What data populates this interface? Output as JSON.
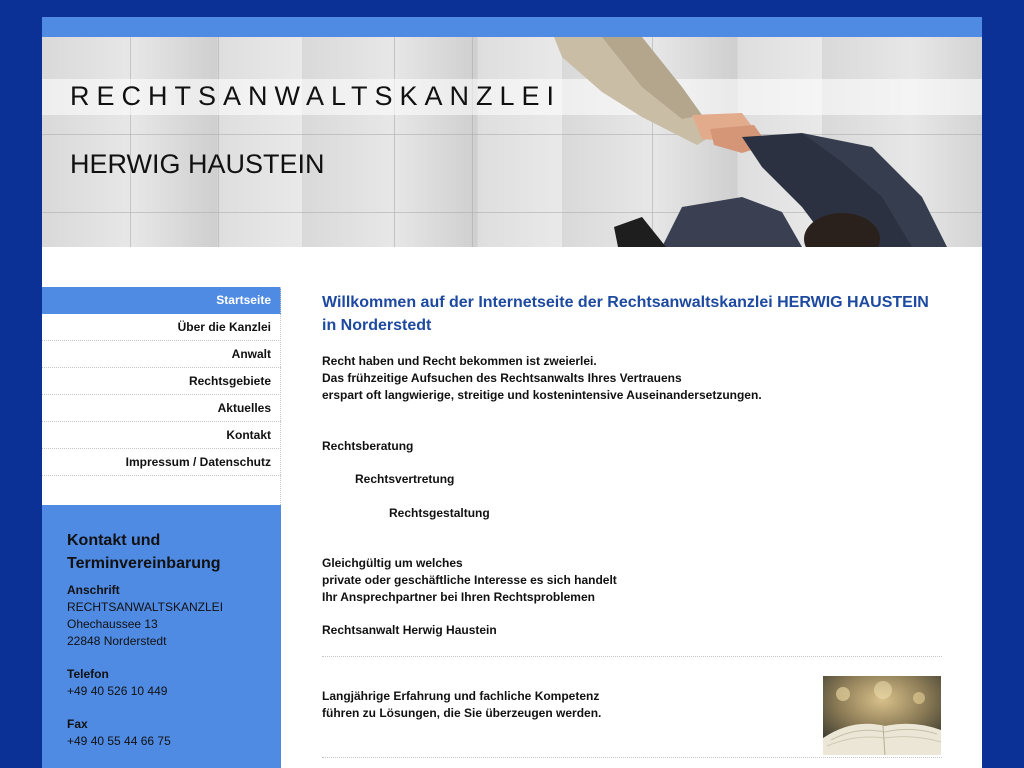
{
  "header": {
    "line1": "RECHTSANWALTSKANZLEI",
    "line2": "HERWIG HAUSTEIN"
  },
  "nav": {
    "items": [
      {
        "label": "Startseite",
        "active": true
      },
      {
        "label": "Über die Kanzlei"
      },
      {
        "label": "Anwalt"
      },
      {
        "label": "Rechtsgebiete"
      },
      {
        "label": "Aktuelles"
      },
      {
        "label": "Kontakt"
      },
      {
        "label": "Impressum / Datenschutz"
      }
    ]
  },
  "contact": {
    "title_line1": "Kontakt und",
    "title_line2": "Terminvereinbarung",
    "address_label": "Anschrift",
    "address_lines": [
      "RECHTSANWALTSKANZLEI",
      "Ohechaussee 13",
      "22848 Norderstedt"
    ],
    "phone_label": "Telefon",
    "phone": "+49 40 526 10 449",
    "fax_label": "Fax",
    "fax": "+49 40 55 44 66 75"
  },
  "main": {
    "title_line1": "Willkommen auf der Internetseite der Rechtsanwaltskanzlei HERWIG HAUSTEIN",
    "title_line2": "in Norderstedt",
    "intro": [
      "Recht haben und Recht bekommen ist zweierlei.",
      "Das frühzeitige Aufsuchen des Rechtsanwalts Ihres Vertrauens",
      "erspart oft langwierige, streitige und kostenintensive Auseinandersetzungen."
    ],
    "services": [
      "Rechtsberatung",
      "Rechtsvertretung",
      "Rechtsgestaltung"
    ],
    "closing": [
      "Gleichgültig um welches",
      "private oder geschäftliche Interesse es sich handelt",
      "Ihr Ansprechpartner bei Ihren Rechtsproblemen"
    ],
    "signature": "Rechtsanwalt Herwig Haustein",
    "experience": [
      "Langjährige Erfahrung und fachliche Kompetenz",
      "führen zu Lösungen, die Sie überzeugen werden."
    ]
  },
  "colors": {
    "background": "#0c3196",
    "accent": "#4f8ae3",
    "heading": "#1d4aa0",
    "text": "#111111"
  }
}
